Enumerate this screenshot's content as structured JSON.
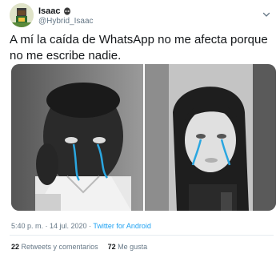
{
  "tweet": {
    "display_name": "Isaac",
    "handle": "@Hybrid_Isaac",
    "text": "A mí la caída de WhatsApp no me afecta porque no me escribe nadie.",
    "timestamp": "5:40 p. m. · 14 jul. 2020 · ",
    "source": "Twitter for Android",
    "retweets_count": "22",
    "retweets_label": "Retweets y comentarios",
    "likes_count": "72",
    "likes_label": "Me gusta"
  },
  "icons": {
    "badge": "alien-icon",
    "menu": "chevron-down-icon"
  },
  "colors": {
    "accent": "#1da1f2",
    "tears": "#2aa6e0",
    "secondary_text": "#657786"
  }
}
